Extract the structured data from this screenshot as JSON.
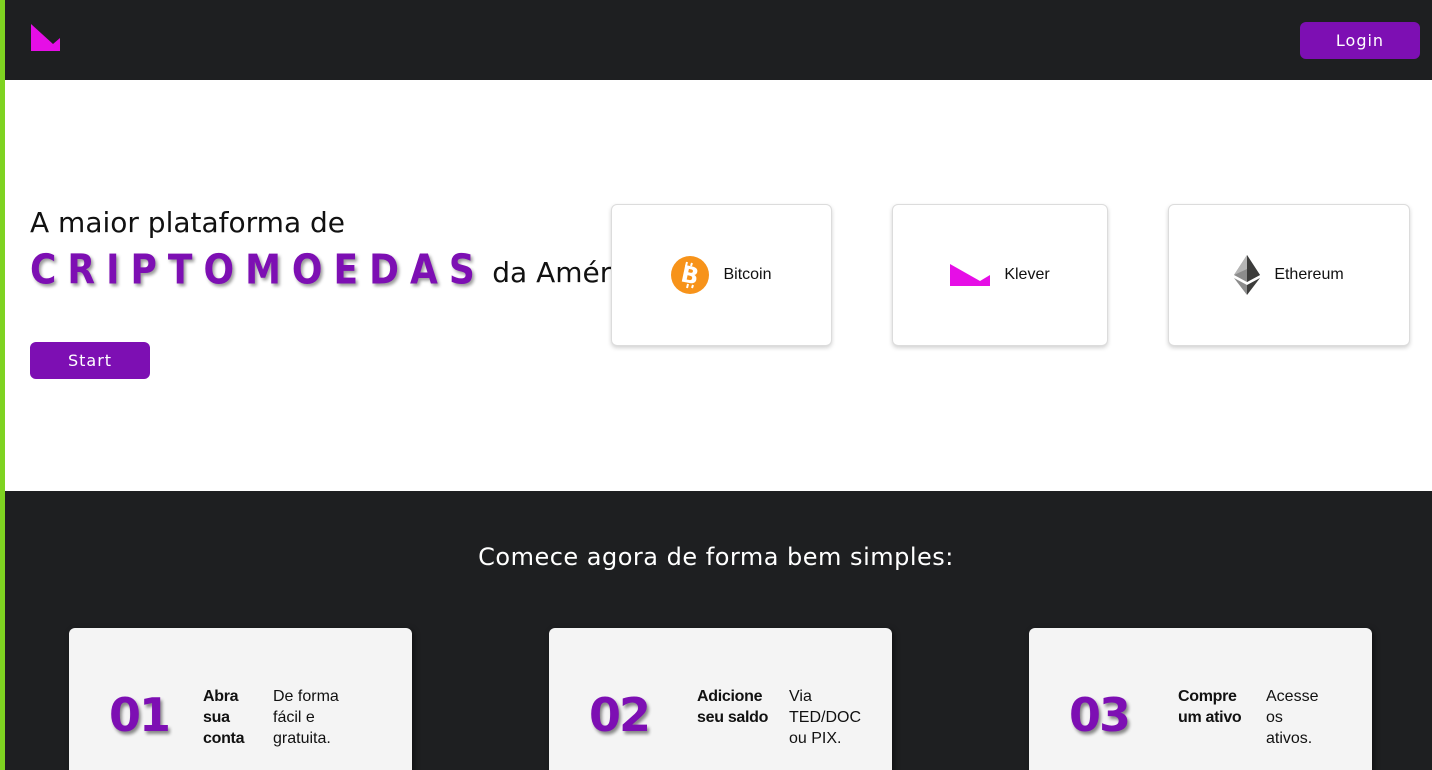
{
  "header": {
    "brand_icon": "klever-logo-icon",
    "login_label": "Login"
  },
  "hero": {
    "line1": "A maior plataforma de",
    "highlight": "CRIPTOMOEDAS",
    "line2_suffix": "da América!",
    "start_label": "Start"
  },
  "coins": [
    {
      "label": "Bitcoin",
      "icon": "bitcoin-icon"
    },
    {
      "label": "Klever",
      "icon": "klever-icon"
    },
    {
      "label": "Ethereum",
      "icon": "ethereum-icon"
    }
  ],
  "steps": {
    "title": "Comece agora de forma bem simples:",
    "items": [
      {
        "number": "01",
        "title": "Abra sua conta",
        "desc": "De forma fácil e gratuita."
      },
      {
        "number": "02",
        "title": "Adicione seu saldo",
        "desc": "Via TED/DOC ou PIX."
      },
      {
        "number": "03",
        "title": "Compre um ativo",
        "desc": "Acesse os ativos."
      }
    ]
  },
  "colors": {
    "accent_purple": "#7d0fb3",
    "dark_bg": "#1e1f21",
    "left_accent_green": "#7ed321",
    "klever_magenta": "#e60ee6",
    "bitcoin_orange": "#f7931a"
  }
}
